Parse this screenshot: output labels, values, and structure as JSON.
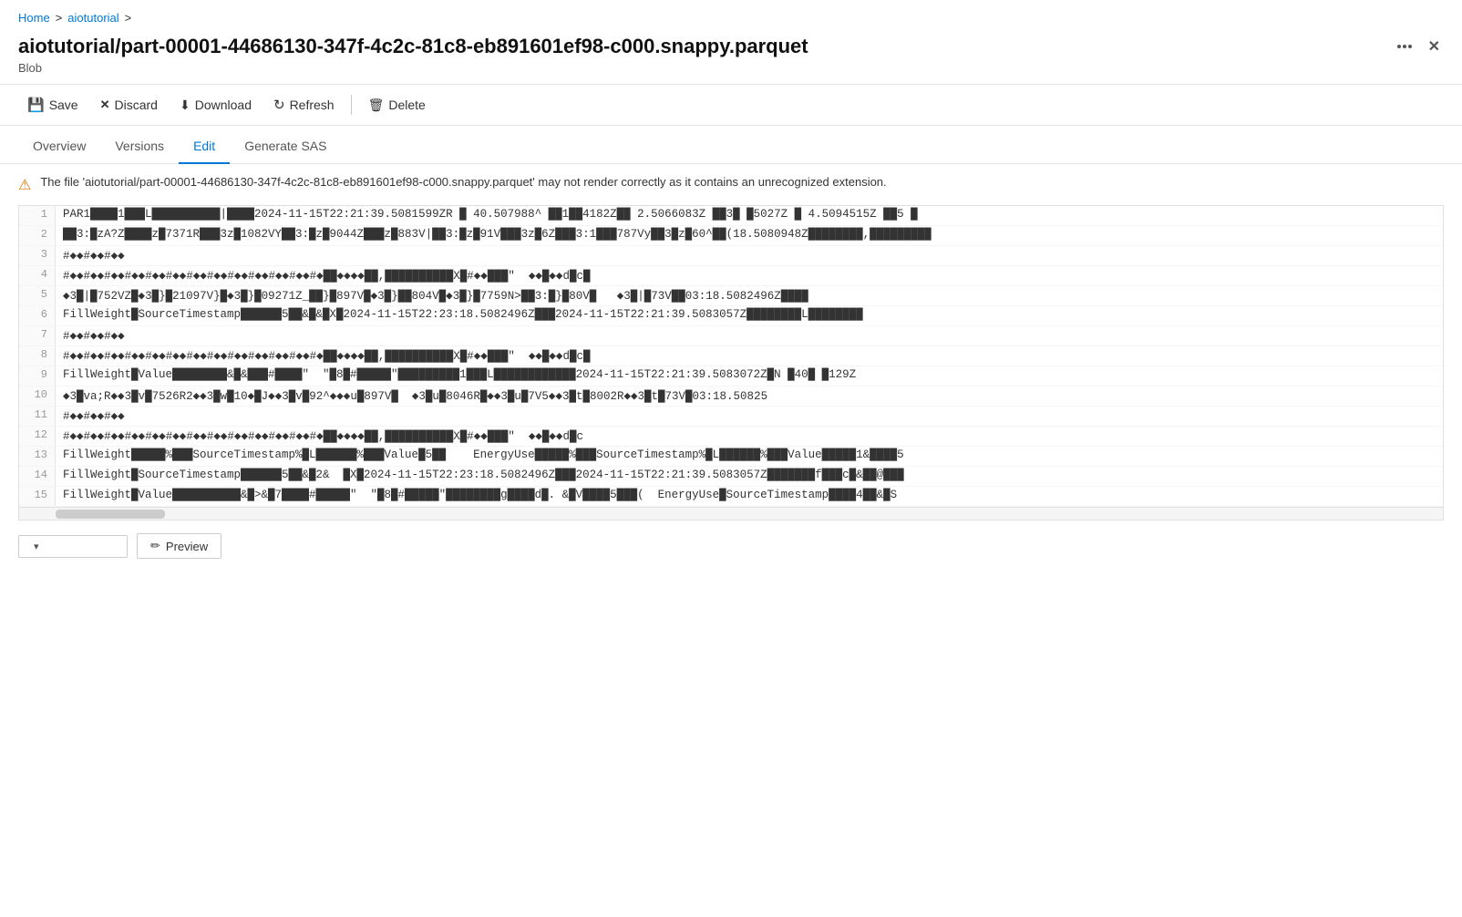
{
  "breadcrumb": {
    "home": "Home",
    "separator1": ">",
    "section": "aiotutorial",
    "separator2": ">"
  },
  "page": {
    "title": "aiotutorial/part-00001-44686130-347f-4c2c-81c8-eb891601ef98-c000.snappy.parquet",
    "subtitle": "Blob"
  },
  "toolbar": {
    "save": "Save",
    "discard": "Discard",
    "download": "Download",
    "refresh": "Refresh",
    "delete": "Delete"
  },
  "tabs": [
    {
      "label": "Overview",
      "active": false
    },
    {
      "label": "Versions",
      "active": false
    },
    {
      "label": "Edit",
      "active": true
    },
    {
      "label": "Generate SAS",
      "active": false
    }
  ],
  "warning": {
    "message": "The file 'aiotutorial/part-00001-44686130-347f-4c2c-81c8-eb891601ef98-c000.snappy.parquet' may not render correctly as it contains an unrecognized extension."
  },
  "editor": {
    "lines": [
      {
        "num": 1,
        "content": "PAR1████1███L██████████|████2024-11-15T22:21:39.5081599ZR █ 40.507988^ ██1██4182Z██ 2.5066083Z ██3█ █5027Z █ 4.5094515Z ██5 █"
      },
      {
        "num": 2,
        "content": "██3:█zA?Z████z█7371R███3z█1082VY██3:█z█9044Z███z█883V|██3:█z█91V███3z█6Z███3:1███787Vy██3█z█60^██(18.5080948Z████████,█████████"
      },
      {
        "num": 3,
        "content": "#◆◆#◆◆#◆◆"
      },
      {
        "num": 4,
        "content": "#◆◆#◆◆#◆◆#◆◆#◆◆#◆◆#◆◆#◆◆#◆◆#◆◆#◆◆#◆◆#◆██◆◆◆◆██,██████████X█#◆◆███\"  ◆◆█◆◆d█c█"
      },
      {
        "num": 5,
        "content": "◆3█|█752VZ█◆3█}█21097V}█◆3█}█09271Z_██}█897V█◆3█}██804V█◆3█}█7759N>██3:█}█80V█   ◆3█|█73V██03:18.5082496Z████"
      },
      {
        "num": 6,
        "content": "FillWeight█SourceTimestamp██████5██&█&█X█2024-11-15T22:23:18.5082496Z███2024-11-15T22:21:39.5083057Z████████L████████"
      },
      {
        "num": 7,
        "content": "#◆◆#◆◆#◆◆"
      },
      {
        "num": 8,
        "content": "#◆◆#◆◆#◆◆#◆◆#◆◆#◆◆#◆◆#◆◆#◆◆#◆◆#◆◆#◆◆#◆██◆◆◆◆██,██████████X█#◆◆███\"  ◆◆█◆◆d█c█"
      },
      {
        "num": 9,
        "content": "FillWeight█Value████████&█&███#████\"  \"█8█#█████\"█████████1███L████████████2024-11-15T22:21:39.5083072Z█N █40█ █129Z"
      },
      {
        "num": 10,
        "content": "◆3█va;R◆◆3█v█7526R2◆◆3█w█10◆█J◆◆3█v█92^◆◆◆u█897V█  ◆3█u█8046R█◆◆3█u█7V5◆◆3█t█8002R◆◆3█t█73V█03:18.50825"
      },
      {
        "num": 11,
        "content": "#◆◆#◆◆#◆◆"
      },
      {
        "num": 12,
        "content": "#◆◆#◆◆#◆◆#◆◆#◆◆#◆◆#◆◆#◆◆#◆◆#◆◆#◆◆#◆◆#◆██◆◆◆◆██,██████████X█#◆◆███\"  ◆◆█◆◆d█c"
      },
      {
        "num": 13,
        "content": "FillWeight█████%███SourceTimestamp%█L██████%███Value█5██    EnergyUse█████%███SourceTimestamp%█L██████%███Value█████1&████5"
      },
      {
        "num": 14,
        "content": "FillWeight█SourceTimestamp██████5██&█2&  █X█2024-11-15T22:23:18.5082496Z███2024-11-15T22:21:39.5083057Z███████f███c█&██@███"
      },
      {
        "num": 15,
        "content": "FillWeight█Value██████████&█>&█7████#█████\"  \"█8█#█████\"████████g████d█. &█V████5███(  EnergyUse█SourceTimestamp████4██&█S"
      }
    ]
  },
  "bottom": {
    "select_placeholder": "",
    "preview_label": "Preview",
    "pencil_icon": "✏"
  },
  "icons": {
    "save": "💾",
    "discard": "✕",
    "download": "⬇",
    "refresh": "↻",
    "delete": "🗑",
    "warning": "⚠",
    "more": "...",
    "close": "✕"
  },
  "colors": {
    "accent": "#0078d4",
    "warning": "#d97706"
  }
}
